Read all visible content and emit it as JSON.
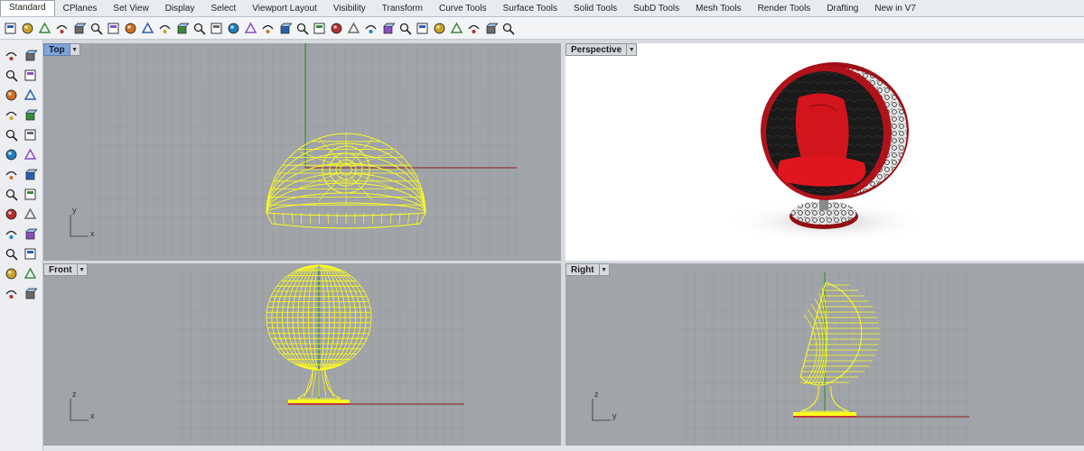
{
  "tabs": [
    "Standard",
    "CPlanes",
    "Set View",
    "Display",
    "Select",
    "Viewport Layout",
    "Visibility",
    "Transform",
    "Curve Tools",
    "Surface Tools",
    "Solid Tools",
    "SubD Tools",
    "Mesh Tools",
    "Render Tools",
    "Drafting",
    "New in V7"
  ],
  "active_tab": "Standard",
  "toolbar_icons": [
    "new-document",
    "open",
    "save",
    "print",
    "import",
    "cut",
    "copy",
    "paste",
    "undo",
    "pan",
    "rotate-view",
    "zoom-dynamic",
    "zoom-window",
    "zoom-extents",
    "zoom-selected",
    "undo-view",
    "four-viewports",
    "car-render",
    "properties",
    "select",
    "camera",
    "light-bulb",
    "lock",
    "layer",
    "color-wheel",
    "render-sphere",
    "solid-sphere",
    "material-sphere",
    "record",
    "globe"
  ],
  "left_icons": [
    "select-arrow",
    "point",
    "polyline",
    "curve-points",
    "arc",
    "circle",
    "rectangle",
    "polygon",
    "ellipse",
    "freeform",
    "box-solid",
    "sphere-solid",
    "cylinder",
    "extrude",
    "boolean",
    "fillet",
    "explode",
    "join",
    "offset",
    "trim",
    "text-tool",
    "mesh",
    "array",
    "gumball",
    "history",
    "analyze"
  ],
  "viewports": {
    "top": {
      "label": "Top",
      "axis_x": "x",
      "axis_y": "y"
    },
    "perspective": {
      "label": "Perspective"
    },
    "front": {
      "label": "Front",
      "axis_x": "x",
      "axis_y": "z"
    },
    "right": {
      "label": "Right",
      "axis_x": "y",
      "axis_y": "z"
    }
  },
  "colors": {
    "wire": "#ffff1e",
    "grid_bg": "#a1a4a8",
    "grid_line": "#8d9095",
    "x_axis": "#8b1a1a",
    "y_axis": "#1f8a1f",
    "chair_red": "#c8141a",
    "chair_shell": "#1c1c1c",
    "active_vp": "#7fa4d6"
  }
}
